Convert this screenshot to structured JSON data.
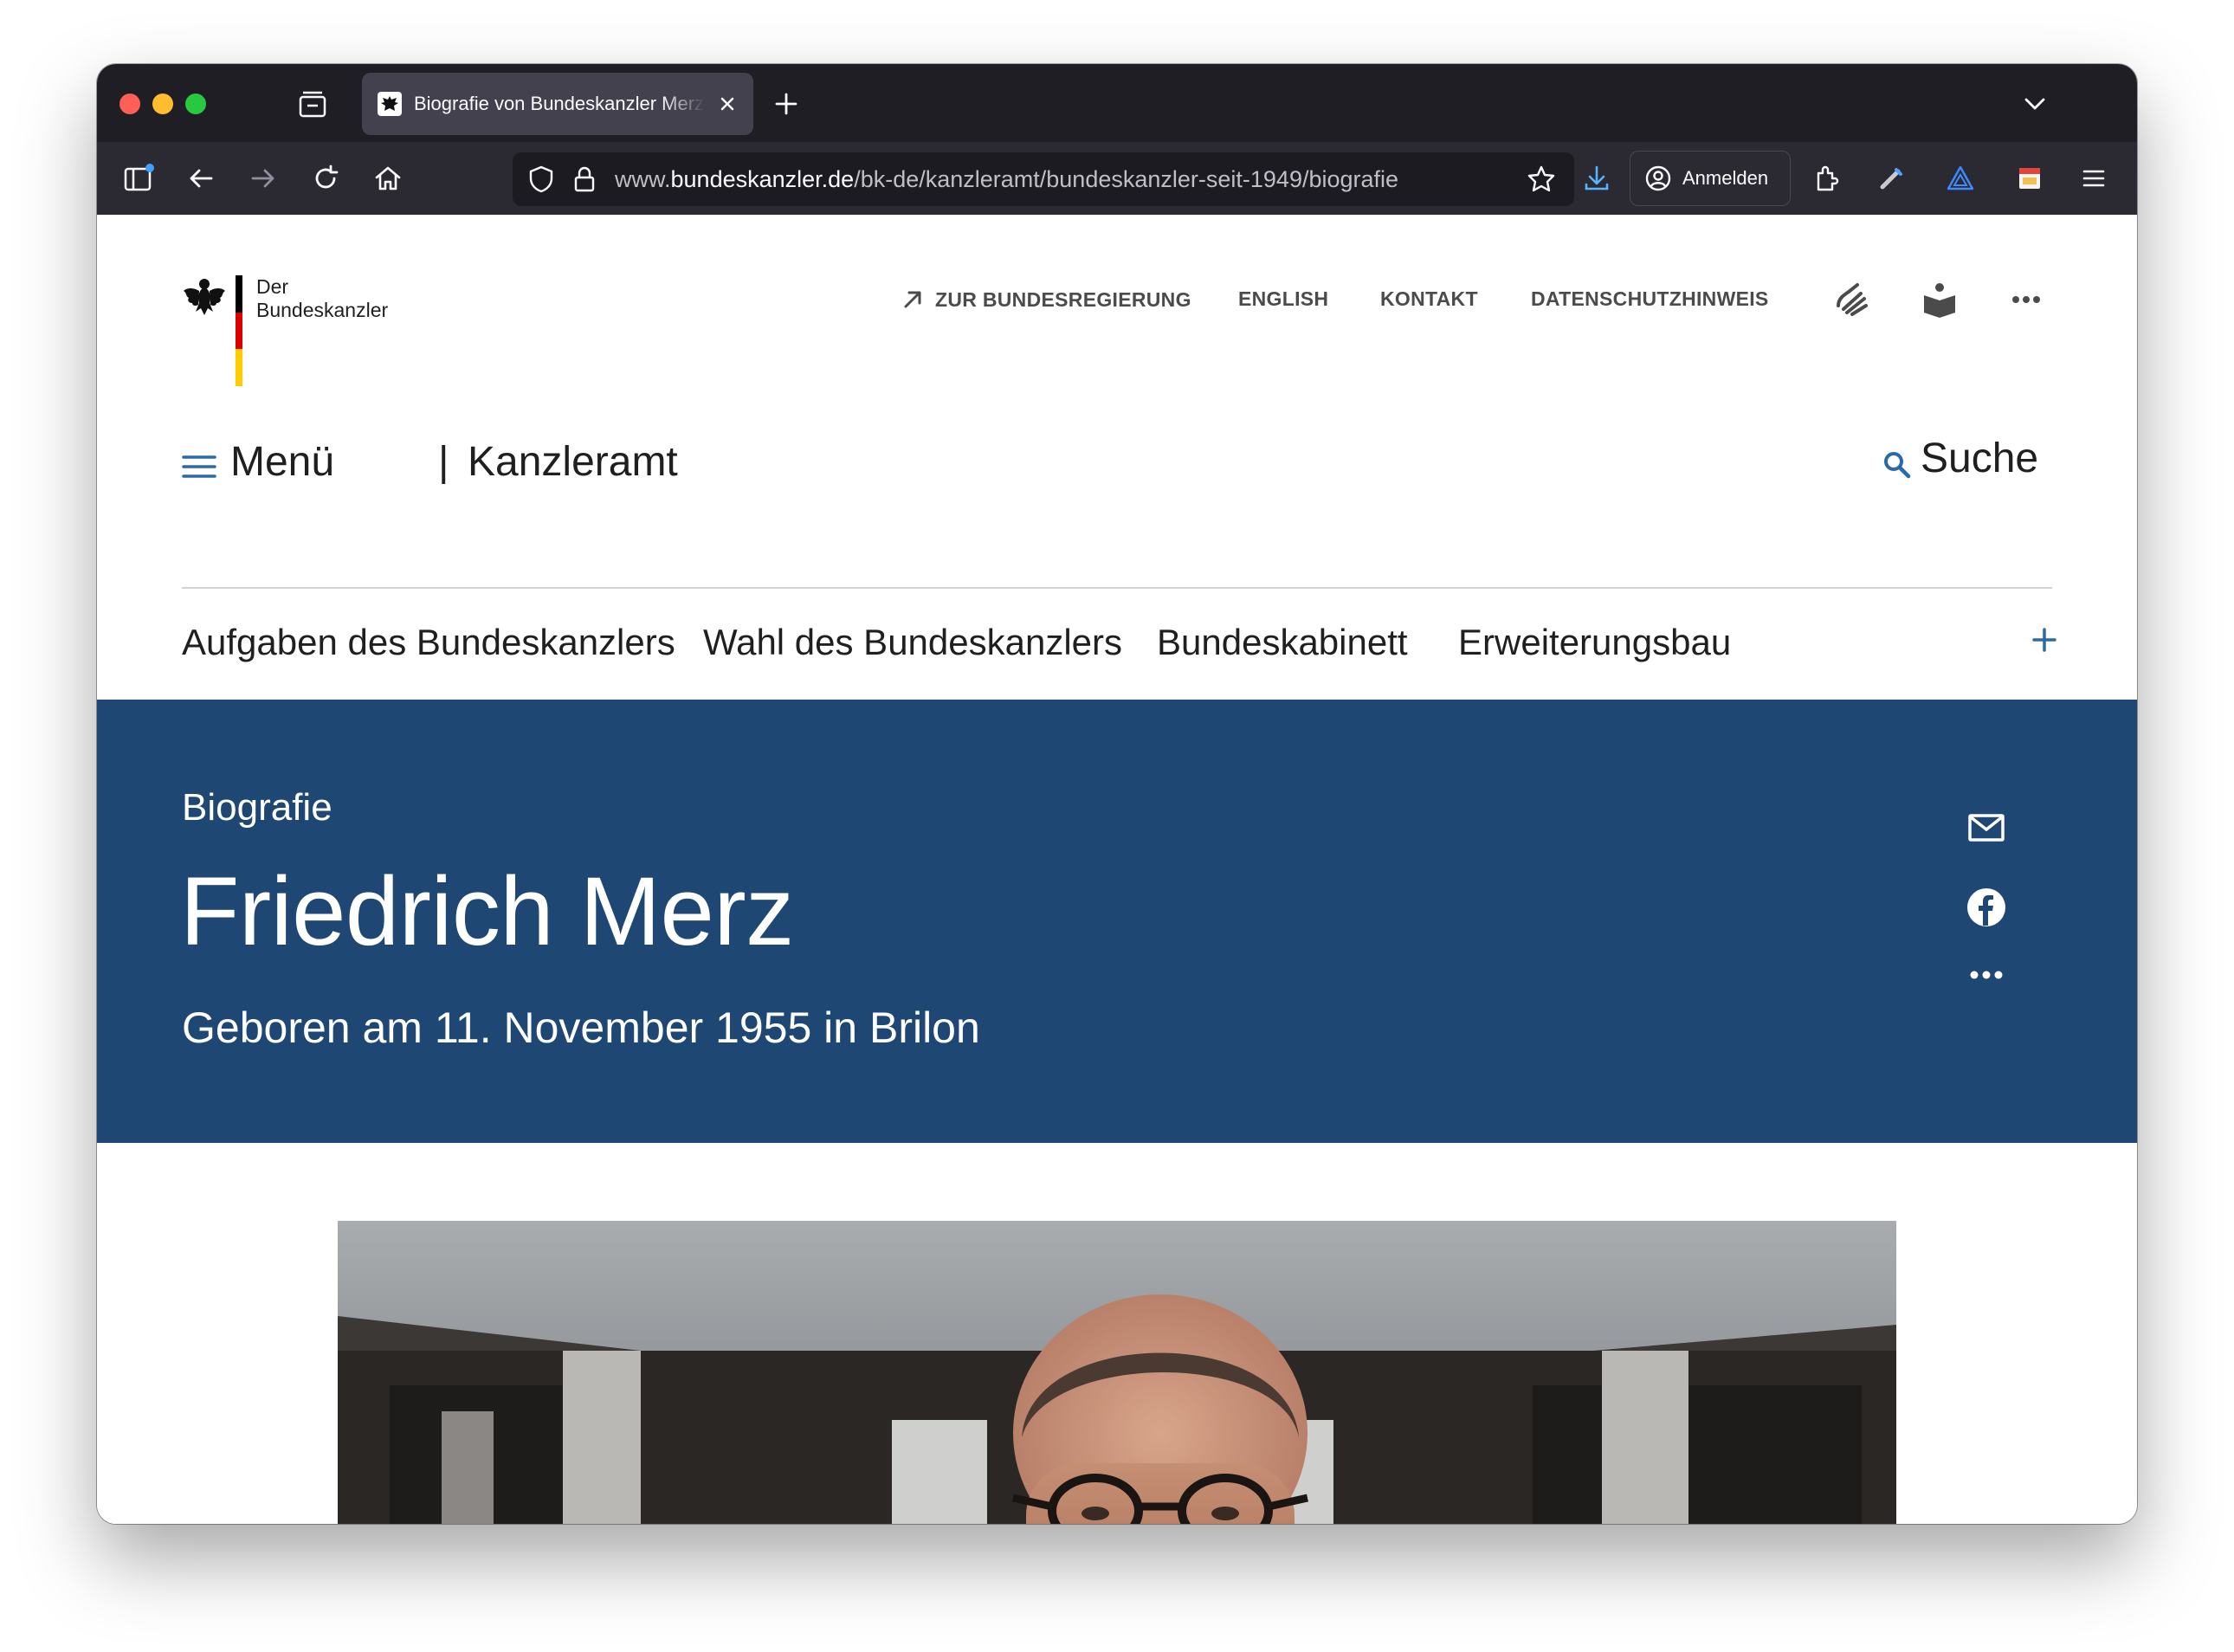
{
  "browser": {
    "tab_title": "Biografie von Bundeskanzler Merz",
    "url_prefix": "www.",
    "url_host": "bundeskanzler.de",
    "url_path": "/bk-de/kanzleramt/bundeskanzler-seit-1949/biografie",
    "signin_label": "Anmelden"
  },
  "site": {
    "logo_line1": "Der",
    "logo_line2": "Bundeskanzler",
    "service_nav": {
      "government_link": "ZUR BUNDESREGIERUNG",
      "english": "ENGLISH",
      "contact": "KONTAKT",
      "privacy": "DATENSCHUTZHINWEIS"
    },
    "menu_label": "Menü",
    "menu_separator": "|",
    "section_label": "Kanzleramt",
    "search_label": "Suche",
    "subnav": [
      "Aufgaben des Bundeskanzlers",
      "Wahl des Bundeskanzlers",
      "Bundeskabinett",
      "Erweiterungsbau"
    ]
  },
  "hero": {
    "kicker": "Biografie",
    "title": "Friedrich Merz",
    "subtitle": "Geboren am 11. November 1955 in Brilon"
  },
  "colors": {
    "hero_blue": "#1f4774",
    "accent_blue": "#2a6aa8",
    "flag_black": "#000000",
    "flag_red": "#dd0000",
    "flag_gold": "#ffcc00"
  }
}
